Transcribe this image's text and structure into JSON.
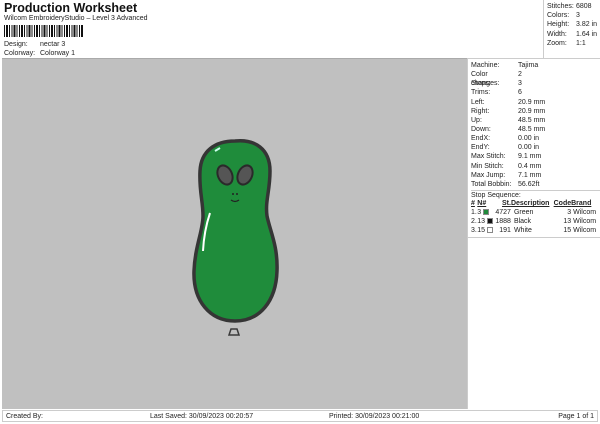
{
  "header": {
    "title": "Production Worksheet",
    "subtitle": "Wilcom EmbroideryStudio – Level 3 Advanced",
    "design_label": "Design:",
    "design": "nectar 3",
    "colorway_label": "Colorway:",
    "colorway": "Colorway 1"
  },
  "stats": [
    {
      "k": "Stitches:",
      "v": "6808"
    },
    {
      "k": "Colors:",
      "v": "3"
    },
    {
      "k": "Height:",
      "v": "3.82 in"
    },
    {
      "k": "Width:",
      "v": "1.64 in"
    },
    {
      "k": "Zoom:",
      "v": "1:1"
    }
  ],
  "info": [
    {
      "k": "Machine:",
      "v": "Tajima"
    },
    {
      "k": "Color changes:",
      "v": "2"
    },
    {
      "k": "Stops:",
      "v": "3"
    },
    {
      "k": "Trims:",
      "v": "6"
    },
    {
      "k": "Left:",
      "v": "20.9 mm"
    },
    {
      "k": "Right:",
      "v": "20.9 mm"
    },
    {
      "k": "Up:",
      "v": "48.5 mm"
    },
    {
      "k": "Down:",
      "v": "48.5 mm"
    },
    {
      "k": "EndX:",
      "v": "0.00 in"
    },
    {
      "k": "EndY:",
      "v": "0.00 in"
    },
    {
      "k": "Max Stitch:",
      "v": "9.1 mm"
    },
    {
      "k": "Min Stitch:",
      "v": "0.4 mm"
    },
    {
      "k": "Max Jump:",
      "v": "7.1 mm"
    },
    {
      "k": "Total Bobbin:",
      "v": "56.62ft"
    }
  ],
  "stop_sequence": {
    "label": "Stop Sequence:",
    "headers": [
      "#",
      "N#",
      "St.",
      "Description",
      "Code",
      "Brand"
    ],
    "rows": [
      {
        "n": "1.",
        "needle": "3",
        "color": "#1e8a3a",
        "st": "4727",
        "desc": "Green",
        "code": "3",
        "brand": "Wilcom"
      },
      {
        "n": "2.",
        "needle": "13",
        "color": "#111111",
        "st": "1888",
        "desc": "Black",
        "code": "13",
        "brand": "Wilcom"
      },
      {
        "n": "3.",
        "needle": "15",
        "color": "#ffffff",
        "st": "191",
        "desc": "White",
        "code": "15",
        "brand": "Wilcom"
      }
    ]
  },
  "footer": {
    "created": "Created By:",
    "saved": "Last Saved: 30/09/2023 00:20:57",
    "printed": "Printed: 30/09/2023 00:21:00",
    "page": "Page 1 of 1"
  }
}
